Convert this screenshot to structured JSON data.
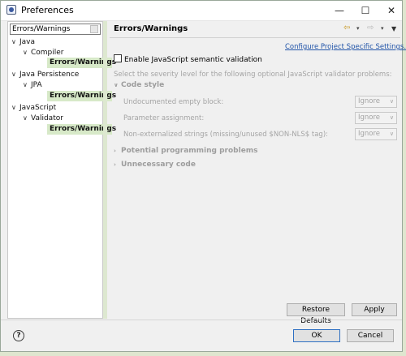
{
  "window": {
    "title": "Preferences",
    "minimize_symbol": "—",
    "maximize_symbol": "☐",
    "close_symbol": "✕"
  },
  "filter": {
    "value": "Errors/Warnings",
    "placeholder": ""
  },
  "tree": {
    "java": "Java",
    "java_compiler": "Compiler",
    "java_compiler_errors": "Errors/Warnings",
    "java_persistence": "Java Persistence",
    "jpa": "JPA",
    "jpa_errors": "Errors/Warnings",
    "javascript": "JavaScript",
    "validator": "Validator",
    "validator_errors": "Errors/Warnings",
    "expanded_arrow": "∨",
    "collapsed_arrow": "›"
  },
  "page": {
    "title": "Errors/Warnings",
    "configure_link": "Configure Project Specific Settings...",
    "enable_label": "Enable JavaScript semantic validation",
    "description": "Select the severity level for the following optional JavaScript validator problems:",
    "sections": {
      "code_style": "Code style",
      "potential": "Potential programming problems",
      "unnecessary": "Unnecessary code"
    },
    "options": [
      {
        "label": "Undocumented empty block:",
        "value": "Ignore"
      },
      {
        "label": "Parameter assignment:",
        "value": "Ignore"
      },
      {
        "label": "Non-externalized strings (missing/unused $NON-NLS$ tag):",
        "value": "Ignore"
      }
    ],
    "toolbar": {
      "back_symbol": "⇦",
      "forward_symbol": "⇨",
      "dropdown_symbol": "▾",
      "menu_symbol": "▼"
    }
  },
  "buttons": {
    "restore_defaults": "Restore Defaults",
    "apply": "Apply",
    "ok": "OK",
    "cancel": "Cancel",
    "help": "?"
  },
  "colors": {
    "selection": "#d7e9c8",
    "link": "#2154a8",
    "default_button_border": "#2d6fc2"
  }
}
